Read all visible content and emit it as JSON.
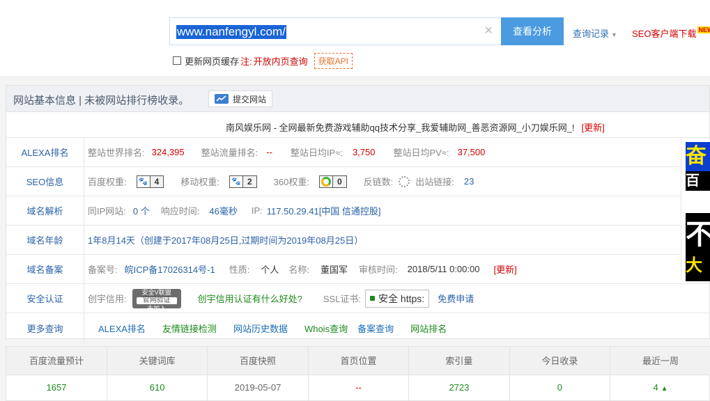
{
  "search": {
    "value": "www.nanfengyl.com/",
    "button": "查看分析",
    "history": "查询记录",
    "seo_download": "SEO客户端下载",
    "new_badge": "NEW",
    "checkbox_label": "更新网页缓存",
    "note_prefix": "注:",
    "note_link": "开放内页查询",
    "api_link": "获取API",
    "clear_icon": "×"
  },
  "panel": {
    "title": "网站基本信息 | 未被网站排行榜收录。",
    "submit_label": "提交网站",
    "site_title": "南风娱乐网 - 全网最新免费游戏辅助qq技术分享_我爱辅助网_善恶资源网_小刀娱乐网_!",
    "update_link": "[更新]"
  },
  "alexa": {
    "label": "ALEXA排名",
    "world_rank_k": "整站世界排名:",
    "world_rank_v": "324,395",
    "traffic_rank_k": "整站流量排名:",
    "traffic_rank_v": "--",
    "ip_k": "整站日均IP≈:",
    "ip_v": "3,750",
    "pv_k": "整站日均PV≈:",
    "pv_v": "37,500"
  },
  "seo": {
    "label": "SEO信息",
    "baidu_k": "百度权重:",
    "baidu_v": "4",
    "mobile_k": "移动权重:",
    "mobile_v": "2",
    "w360_k": "360权重:",
    "w360_v": "0",
    "backlinks_k": "反链数:",
    "outlinks_k": "出站链接:",
    "outlinks_v": "23",
    "paw_icon": "🐾"
  },
  "domain": {
    "label": "域名解析",
    "same_ip_k": "同IP网站:",
    "same_ip_v": "0 个",
    "resp_k": "响应时间:",
    "resp_v": "46毫秒",
    "ip_k": "IP:",
    "ip_v": "117.50.29.41[中国 信通控股]"
  },
  "age": {
    "label": "域名年龄",
    "value": "1年8月14天（创建于2017年08月25日,过期时间为2019年08月25日）"
  },
  "icp": {
    "label": "域名备案",
    "no_k": "备案号:",
    "no_v": "皖ICP备17026314号-1",
    "type_k": "性质:",
    "type_v": "个人",
    "name_k": "名称:",
    "name_v": "董国军",
    "audit_k": "审核时间:",
    "audit_v": "2018/5/11 0:00:00",
    "update_link": "[更新]"
  },
  "security": {
    "label": "安全认证",
    "trust_k": "创宇信用:",
    "badge_top": "安全V联盟",
    "badge_mid": "官网验证",
    "badge_bot": "未加入",
    "trust_link": "创宇信用认证有什么好处?",
    "ssl_k": "SSL证书:",
    "ssl_badge": "安全 https:",
    "apply_link": "免费申请"
  },
  "more": {
    "label": "更多查询",
    "links": [
      "ALEXA排名",
      "友情链接检测",
      "网站历史数据",
      "Whois查询",
      "备案查询",
      "网站排名"
    ]
  },
  "ad": {
    "t1": "百度",
    "t2": "不",
    "t3": "大"
  },
  "stats": {
    "headers": [
      "百度流量预计",
      "关键词库",
      "百度快照",
      "首页位置",
      "索引量",
      "今日收录",
      "最近一周"
    ],
    "values": [
      "1657",
      "610",
      "2019-05-07",
      "--",
      "2723",
      "0",
      "4"
    ],
    "up_icon": "▲"
  }
}
